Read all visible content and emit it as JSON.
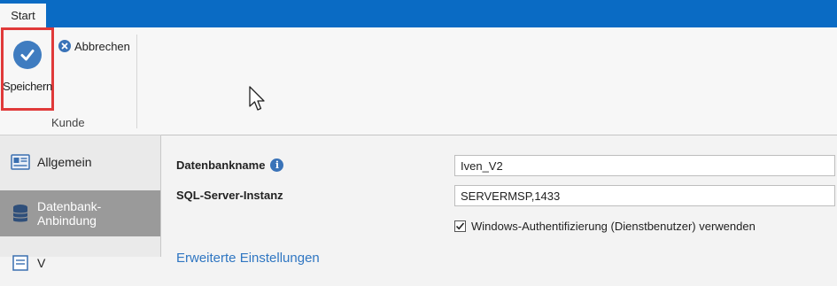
{
  "ribbon": {
    "tab_start": "Start",
    "save_label": "Speichern",
    "cancel_label": "Abbrechen",
    "group_label": "Kunde"
  },
  "sidebar": {
    "items": [
      {
        "label": "Allgemein",
        "icon": "id-card-icon",
        "active": false
      },
      {
        "label": "Datenbank-Anbindung",
        "icon": "database-icon",
        "active": true
      },
      {
        "label": "V",
        "icon": "list-icon",
        "active": false
      }
    ]
  },
  "form": {
    "database_name_label": "Datenbankname",
    "database_name_value": "Iven_V2",
    "sql_instance_label": "SQL-Server-Instanz",
    "sql_instance_value": "SERVERMSP,1433",
    "windows_auth_label": "Windows-Authentifizierung (Dienstbenutzer) verwenden",
    "windows_auth_checked": true,
    "advanced_link": "Erweiterte Einstellungen"
  },
  "colors": {
    "titlebar": "#0a6bc4",
    "highlight_box": "#e03a3a",
    "sidebar_active": "#9a9a9a",
    "link": "#2f76c2"
  }
}
